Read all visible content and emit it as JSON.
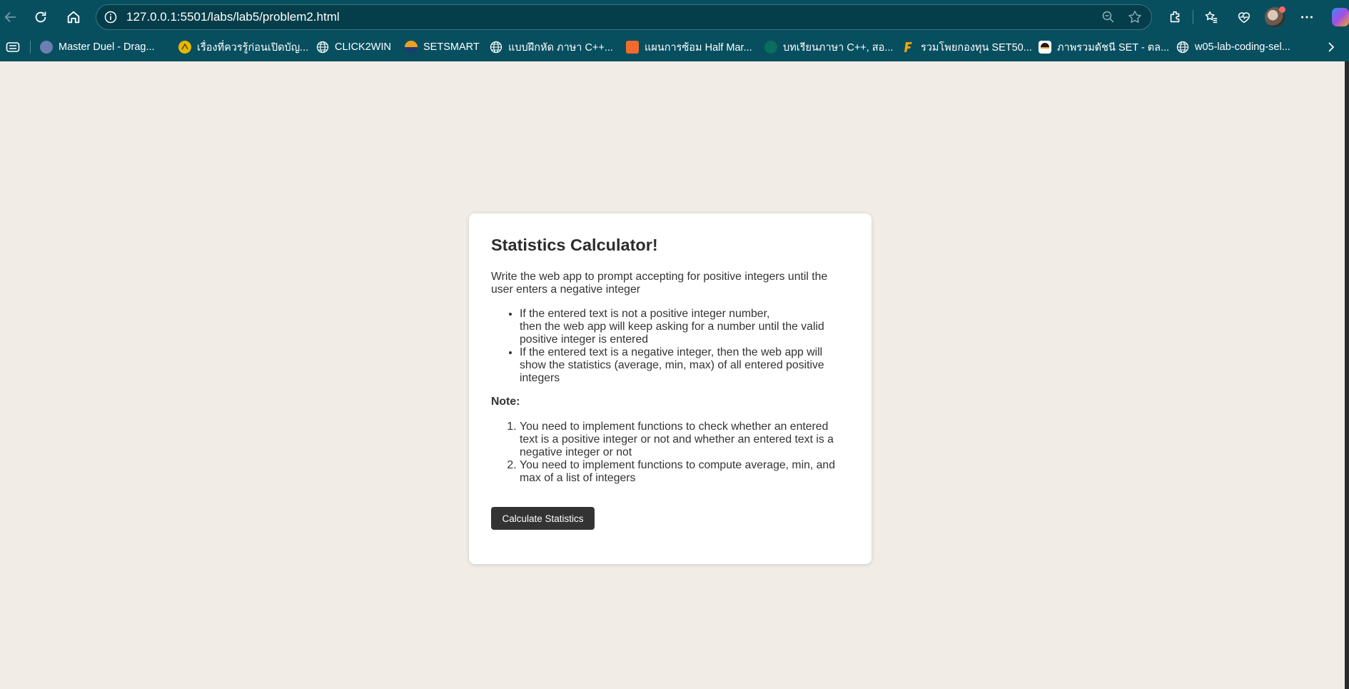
{
  "browser": {
    "url": "127.0.0.1:5501/labs/lab5/problem2.html",
    "accent": "#074f5f",
    "bookmarks": [
      {
        "label": "Master Duel - Drag...",
        "icon": "game-icon",
        "color": "#6b7fb0"
      },
      {
        "label": "เรื่องที่ควรรู้ก่อนเปิดบัญ...",
        "icon": "bank-icon",
        "color": "#e8b800"
      },
      {
        "label": "CLICK2WIN",
        "icon": "globe-icon",
        "color": ""
      },
      {
        "label": "SETSMART",
        "icon": "setsmart-icon",
        "color": "#f0a020"
      },
      {
        "label": "แบบฝึกหัด ภาษา C++...",
        "icon": "globe-icon",
        "color": ""
      },
      {
        "label": "แผนการซ้อม Half Mar...",
        "icon": "run-icon",
        "color": "#f26b2d"
      },
      {
        "label": "บทเรียนภาษา C++, สอ...",
        "icon": "dot-icon",
        "color": "#0b6d5e"
      },
      {
        "label": "รวมโพยกองทุน SET50...",
        "icon": "fund-icon",
        "color": "#f5a300"
      },
      {
        "label": "ภาพรวมดัชนี SET - ตล...",
        "icon": "set-icon",
        "color": "#ffffff"
      },
      {
        "label": "w05-lab-coding-sel...",
        "icon": "globe-icon",
        "color": ""
      }
    ]
  },
  "card": {
    "title": "Statistics Calculator!",
    "intro": "Write the web app to prompt accepting for positive integers until the user enters a negative integer",
    "bullets": [
      "If the entered text is not a positive integer number,",
      "then the web app will keep asking for a number until the valid positive integer is entered",
      "If the entered text is a negative integer, then the web app will show the statistics (average, min, max) of all entered positive integers"
    ],
    "note_label": "Note:",
    "notes": [
      "You need to implement functions to check whether an entered text is a positive integer or not and whether an entered text is a negative integer or not",
      "You need to implement functions to compute average, min, and max of a list of integers"
    ],
    "button_label": "Calculate Statistics"
  }
}
